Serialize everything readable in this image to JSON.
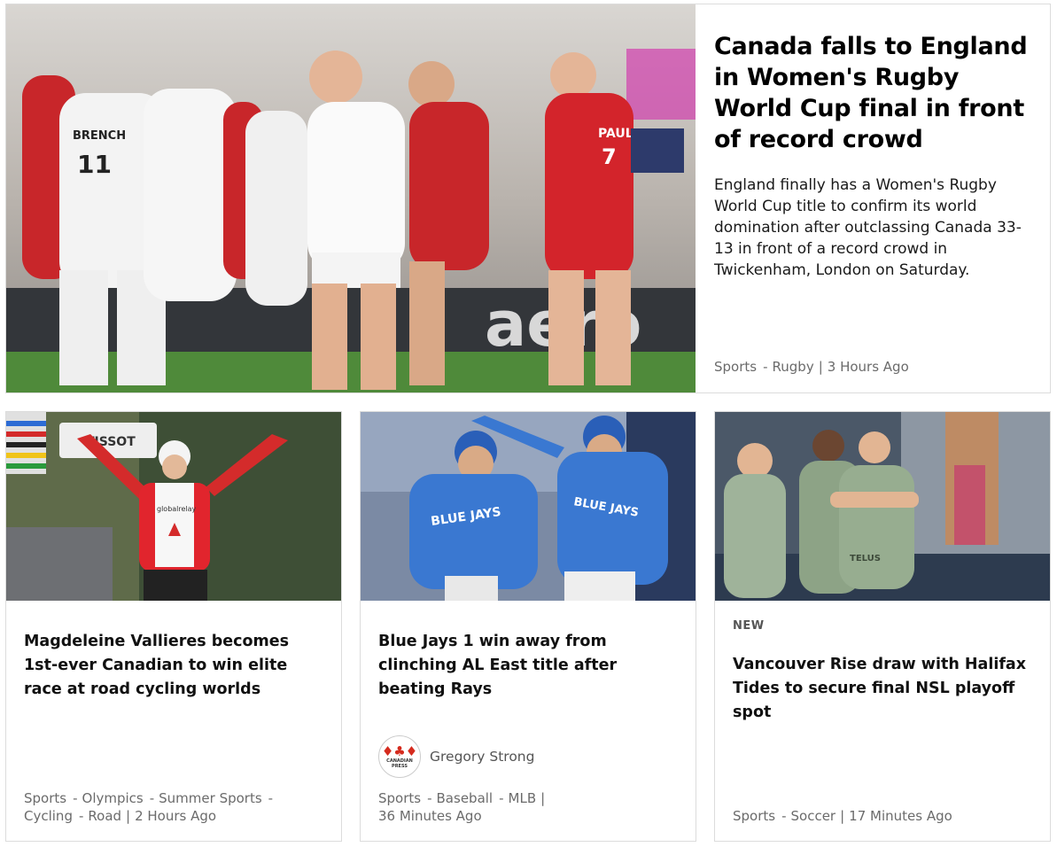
{
  "hero": {
    "title": "Canada falls to England in Women's Rugby World Cup final in front of record crowd",
    "description": "England finally has a Women's Rugby World Cup title to confirm its world domination after outclassing Canada 33-13 in front of a record crowd in Twickenham, London on Saturday.",
    "meta": {
      "category": "Sports",
      "subcategory": "Rugby",
      "time": "3 Hours Ago"
    },
    "image_text": {
      "jersey_1": "BRENCH",
      "jersey_1_number": "11",
      "jersey_2": "PAUL",
      "jersey_2_number": "7",
      "board": "aero"
    }
  },
  "cards": [
    {
      "title": "Magdeleine Vallieres becomes 1st-ever Canadian to win elite race at road cycling worlds",
      "meta": {
        "line1": [
          "Sports",
          "Olympics",
          "Summer Sports"
        ],
        "line2": [
          "Cycling",
          "Road"
        ],
        "time": "2 Hours Ago"
      },
      "image_text": {
        "sign": "TISSOT",
        "jersey": "globalrelay"
      }
    },
    {
      "title": "Blue Jays 1 win away from clinching AL East title after beating Rays",
      "author": {
        "name": "Gregory Strong",
        "logo_text": "CANADIAN PRESS"
      },
      "meta": {
        "line1": [
          "Sports",
          "Baseball",
          "MLB"
        ],
        "time": "36 Minutes Ago"
      },
      "image_text": {
        "jersey_left": "BLUE JAYS",
        "jersey_right": "BLUE JAYS"
      }
    },
    {
      "badge": "NEW",
      "title": "Vancouver Rise draw with Halifax Tides to secure final NSL playoff spot",
      "meta": {
        "line1": [
          "Sports",
          "Soccer"
        ],
        "time": "17 Minutes Ago"
      },
      "image_text": {
        "jersey": "TELUS"
      }
    }
  ],
  "colors": {
    "canada_red": "#d52b1e",
    "jays_blue": "#2f6fc9",
    "pitch_green": "#4f8a3a",
    "rise_green": "#8da386"
  }
}
